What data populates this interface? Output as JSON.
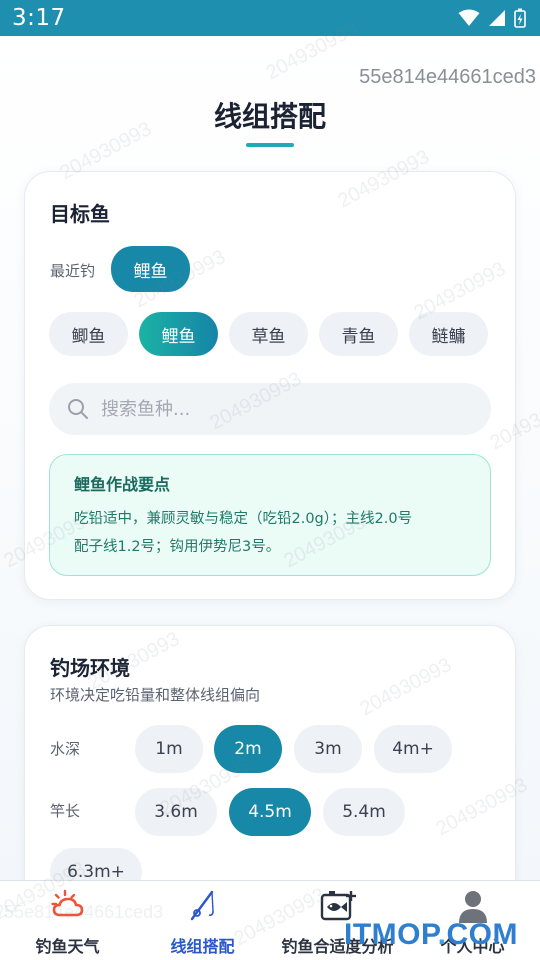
{
  "status_bar": {
    "time": "3:17"
  },
  "device_id": "55e814e44661ced3",
  "page_title": "线组搭配",
  "target_fish": {
    "title": "目标鱼",
    "recent_label": "最近钓",
    "recent_chip": "鲤鱼",
    "fish_options": [
      "鲫鱼",
      "鲤鱼",
      "草鱼",
      "青鱼",
      "鲢鳙"
    ],
    "selected_fish": "鲤鱼",
    "search": {
      "value": "",
      "placeholder": "搜索鱼种..."
    },
    "tip": {
      "title": "鲤鱼作战要点",
      "line1": "吃铅适中，兼顾灵敏与稳定（吃铅2.0g）；主线2.0号",
      "line2": "配子线1.2号；钩用伊势尼3号。"
    }
  },
  "environment": {
    "title": "钓场环境",
    "subtitle": "环境决定吃铅量和整体线组偏向",
    "depth_label": "水深",
    "depth_options": [
      "1m",
      "2m",
      "3m",
      "4m+"
    ],
    "depth_selected": "2m",
    "rod_label": "竿长",
    "rod_options": [
      "3.6m",
      "4.5m",
      "5.4m",
      "6.3m+"
    ],
    "rod_selected": "4.5m"
  },
  "bottom_nav": {
    "items": [
      {
        "label": "钓鱼天气",
        "icon": "weather-icon"
      },
      {
        "label": "线组搭配",
        "icon": "fishing-rod-icon"
      },
      {
        "label": "钓鱼合适度分析",
        "icon": "fish-analysis-icon"
      },
      {
        "label": "个人中心",
        "icon": "user-icon"
      }
    ],
    "active_index": 1
  },
  "watermark": {
    "text": "204930993"
  },
  "overlay_watermark_text": "55e814e44661ced3",
  "brand_logo": {
    "text_main": "ITMOP",
    "text_dot": ".",
    "text_tail": "COM"
  },
  "colors": {
    "status_bar": "#1f8fb0",
    "accent": "#1788a8",
    "accent_gradient_start": "#1bb3a4",
    "tip_bg": "#ebfbf6",
    "nav_active": "#2a58c8",
    "title_underline": "#1faab6"
  }
}
